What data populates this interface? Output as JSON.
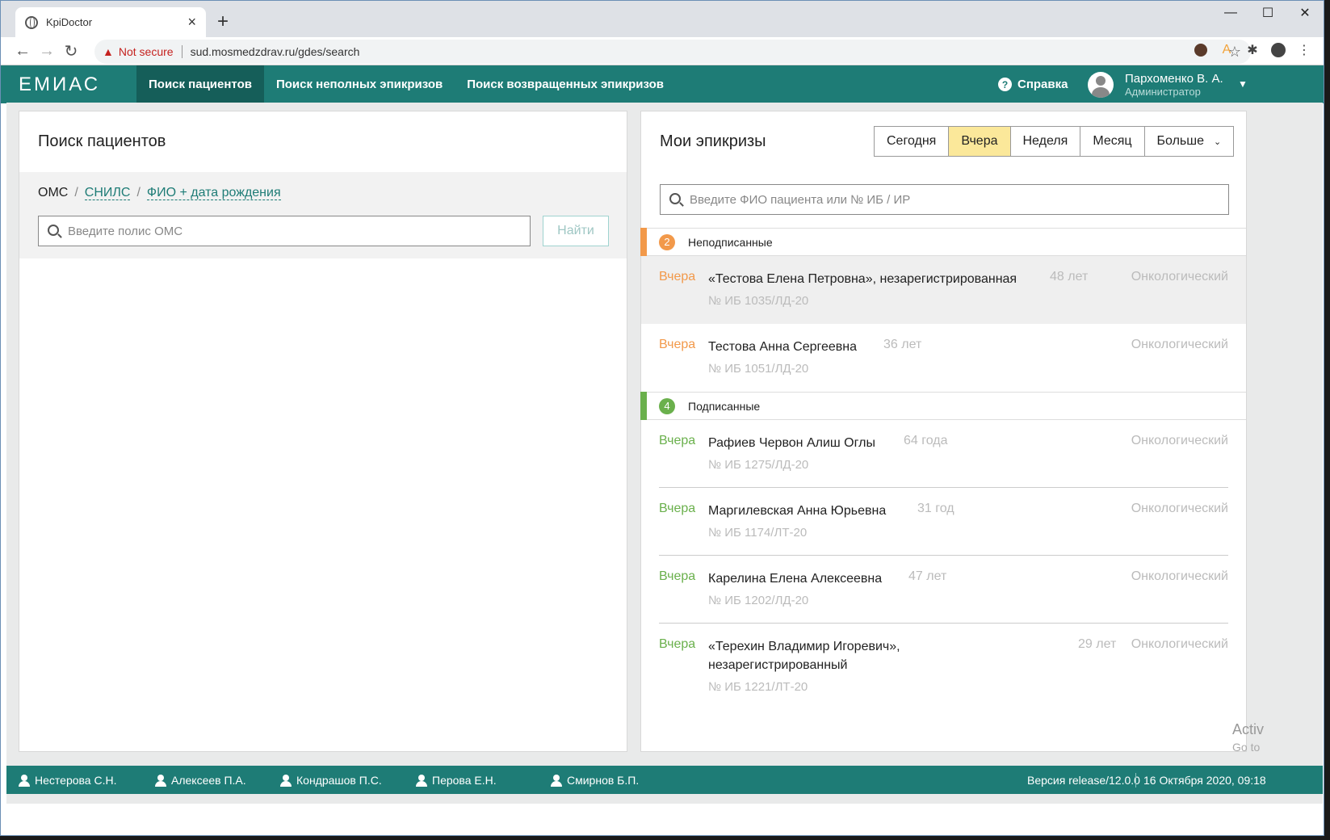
{
  "browser": {
    "tab_title": "KpiDoctor",
    "new_tab": "+",
    "not_secure": "Not secure",
    "url": "sud.mosmedzdrav.ru/gdes/search"
  },
  "header": {
    "logo": "ЕМИАС",
    "nav": [
      {
        "label": "Поиск пациентов"
      },
      {
        "label": "Поиск неполных эпикризов"
      },
      {
        "label": "Поиск возвращенных эпикризов"
      }
    ],
    "help": "Справка",
    "user_name": "Пархоменко В. А.",
    "user_role": "Администратор"
  },
  "left": {
    "title": "Поиск пациентов",
    "crumb_oms": "ОМС",
    "crumb_snils": "СНИЛС",
    "crumb_fio": "ФИО + дата рождения",
    "sep": "/",
    "placeholder": "Введите полис ОМС",
    "find": "Найти"
  },
  "right": {
    "title": "Мои эпикризы",
    "periods": [
      "Сегодня",
      "Вчера",
      "Неделя",
      "Месяц",
      "Больше"
    ],
    "placeholder": "Введите ФИО пациента или № ИБ / ИР",
    "unsigned": {
      "count": "2",
      "label": "Неподписанные",
      "color": "#f2994a"
    },
    "signed": {
      "count": "4",
      "label": "Подписанные",
      "color": "#6ab04c"
    },
    "unsigned_rows": [
      {
        "when": "Вчера",
        "name": "«Тестова Елена Петровна», незарегистрированная",
        "age": "48 лет",
        "dept": "Онкологический",
        "ib": "№ ИБ 1035/ЛД-20"
      },
      {
        "when": "Вчера",
        "name": "Тестова Анна Сергеевна",
        "age": "36 лет",
        "dept": "Онкологический",
        "ib": "№ ИБ 1051/ЛД-20"
      }
    ],
    "signed_rows": [
      {
        "when": "Вчера",
        "name": "Рафиев Червон Алиш Оглы",
        "age": "64 года",
        "dept": "Онкологический",
        "ib": "№ ИБ 1275/ЛД-20"
      },
      {
        "when": "Вчера",
        "name": "Маргилевская Анна Юрьевна",
        "age": "31 год",
        "dept": "Онкологический",
        "ib": "№ ИБ 1174/ЛТ-20"
      },
      {
        "when": "Вчера",
        "name": "Карелина Елена Алексеевна",
        "age": "47 лет",
        "dept": "Онкологический",
        "ib": "№ ИБ 1202/ЛД-20"
      },
      {
        "when": "Вчера",
        "name1": "«Терехин Владимир Игоревич»,",
        "name2": "незарегистрированный",
        "age": "29 лет",
        "dept": "Онкологический",
        "ib": "№ ИБ 1221/ЛТ-20"
      }
    ]
  },
  "footer": {
    "users": [
      "Нестерова С.Н.",
      "Алексеев П.А.",
      "Кондрашов П.С.",
      "Перова Е.Н.",
      "Смирнов Б.П."
    ],
    "version": "Версия release/12.0.0",
    "datetime": "16 Октября 2020, 09:18"
  },
  "watermark": {
    "line1": "Activ",
    "line2": "Go to"
  }
}
